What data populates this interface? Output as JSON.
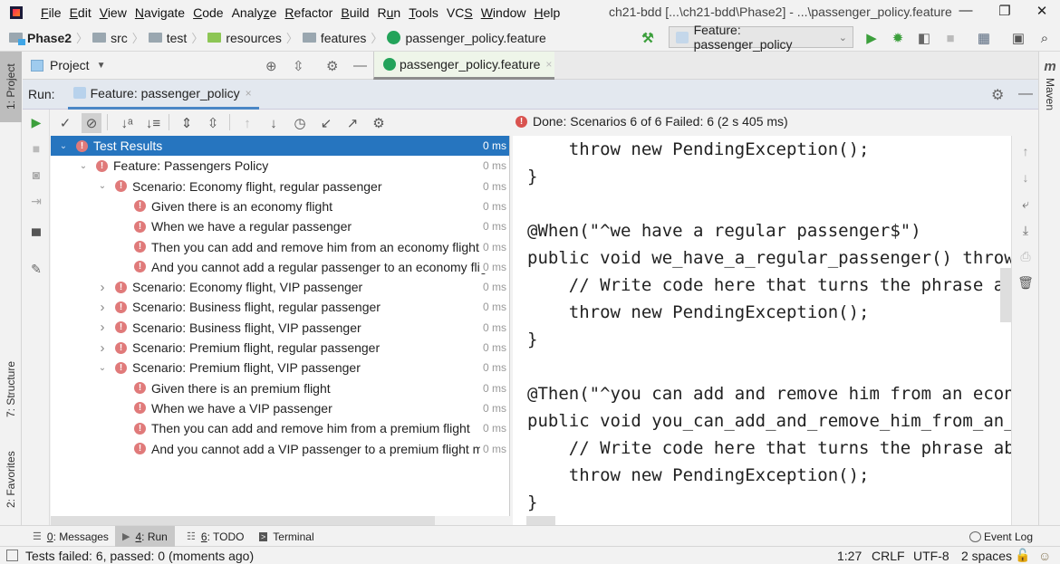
{
  "menubar": {
    "items": [
      {
        "pre": "",
        "ul": "F",
        "post": "ile"
      },
      {
        "pre": "",
        "ul": "E",
        "post": "dit"
      },
      {
        "pre": "",
        "ul": "V",
        "post": "iew"
      },
      {
        "pre": "",
        "ul": "N",
        "post": "avigate"
      },
      {
        "pre": "",
        "ul": "C",
        "post": "ode"
      },
      {
        "pre": "Analy",
        "ul": "z",
        "post": "e"
      },
      {
        "pre": "",
        "ul": "R",
        "post": "efactor"
      },
      {
        "pre": "",
        "ul": "B",
        "post": "uild"
      },
      {
        "pre": "R",
        "ul": "u",
        "post": "n"
      },
      {
        "pre": "",
        "ul": "T",
        "post": "ools"
      },
      {
        "pre": "VC",
        "ul": "S",
        "post": ""
      },
      {
        "pre": "",
        "ul": "W",
        "post": "indow"
      },
      {
        "pre": "",
        "ul": "H",
        "post": "elp"
      }
    ],
    "window_title": "ch21-bdd [...\\ch21-bdd\\Phase2] - ...\\passenger_policy.feature",
    "minimize": "—",
    "restore": "❐",
    "close": "✕"
  },
  "navbar": {
    "breadcrumbs": [
      "Phase2",
      "src",
      "test",
      "resources",
      "features",
      "passenger_policy.feature"
    ],
    "separator": "〉",
    "run_config": "Feature: passenger_policy"
  },
  "left_stripe": {
    "project": "1: Project",
    "structure": "7: Structure",
    "favorites": "2: Favorites"
  },
  "right_stripe": {
    "maven_icon": "m",
    "maven": "Maven"
  },
  "project_bar": {
    "label": "Project",
    "dropdown": "▼"
  },
  "editor": {
    "tab_label": "passenger_policy.feature",
    "tab_close": "×"
  },
  "run_panel": {
    "label": "Run:",
    "tab_label": "Feature: passenger_policy",
    "tab_close": "×",
    "status": "Done: Scenarios 6 of 6  Failed: 6  (2 s 405 ms)"
  },
  "test_tree": [
    {
      "label": "Test Results",
      "time": "0 ms",
      "level": 0,
      "arrow": "expanded",
      "selected": true
    },
    {
      "label": "Feature: Passengers Policy",
      "time": "0 ms",
      "level": 1,
      "arrow": "expanded"
    },
    {
      "label": "Scenario: Economy flight, regular passenger",
      "time": "0 ms",
      "level": 2,
      "arrow": "expanded"
    },
    {
      "label": "Given there is an economy flight",
      "time": "0 ms",
      "level": 3,
      "arrow": "none"
    },
    {
      "label": "When we have a regular passenger",
      "time": "0 ms",
      "level": 3,
      "arrow": "none"
    },
    {
      "label": "Then you can add and remove him from an economy flight",
      "time": "0 ms",
      "level": 3,
      "arrow": "none"
    },
    {
      "label": "And you cannot add a regular passenger to an economy flight",
      "time": "0 ms",
      "level": 3,
      "arrow": "none"
    },
    {
      "label": "Scenario: Economy flight, VIP passenger",
      "time": "0 ms",
      "level": 2,
      "arrow": "collapsed"
    },
    {
      "label": "Scenario: Business flight, regular passenger",
      "time": "0 ms",
      "level": 2,
      "arrow": "collapsed"
    },
    {
      "label": "Scenario: Business flight, VIP passenger",
      "time": "0 ms",
      "level": 2,
      "arrow": "collapsed"
    },
    {
      "label": "Scenario: Premium flight, regular passenger",
      "time": "0 ms",
      "level": 2,
      "arrow": "collapsed"
    },
    {
      "label": "Scenario: Premium flight, VIP passenger",
      "time": "0 ms",
      "level": 2,
      "arrow": "expanded"
    },
    {
      "label": "Given there is an premium flight",
      "time": "0 ms",
      "level": 3,
      "arrow": "none"
    },
    {
      "label": "When we have a VIP passenger",
      "time": "0 ms",
      "level": 3,
      "arrow": "none"
    },
    {
      "label": "Then you can add and remove him from a premium flight",
      "time": "0 ms",
      "level": 3,
      "arrow": "none"
    },
    {
      "label": "And you cannot add a VIP passenger to a premium flight mor",
      "time": "0 ms",
      "level": 3,
      "arrow": "none"
    }
  ],
  "console_lines": [
    "    throw new PendingException();",
    "}",
    "",
    "@When(\"^we have a regular passenger$\")",
    "public void we_have_a_regular_passenger() throws",
    "    // Write code here that turns the phrase abo",
    "    throw new PendingException();",
    "}",
    "",
    "@Then(\"^you can add and remove him from an econo",
    "public void you_can_add_and_remove_him_from_an_e",
    "    // Write code here that turns the phrase abo",
    "    throw new PendingException();",
    "}"
  ],
  "toolwindows": {
    "messages": {
      "ul": "0",
      "rest": ": Messages"
    },
    "run": {
      "ul": "4",
      "rest": ": Run"
    },
    "todo": {
      "ul": "6",
      "rest": ": TODO"
    },
    "terminal": "Terminal",
    "event_log": "Event Log"
  },
  "statusbar": {
    "message": "Tests failed: 6, passed: 0 (moments ago)",
    "position": "1:27",
    "line_sep": "CRLF",
    "encoding": "UTF-8",
    "indent": "2 spaces"
  },
  "colors": {
    "selection": "#2675bf",
    "error": "#e07a7a",
    "run_green": "#3c9f3c",
    "cucumber": "#23a35a"
  }
}
